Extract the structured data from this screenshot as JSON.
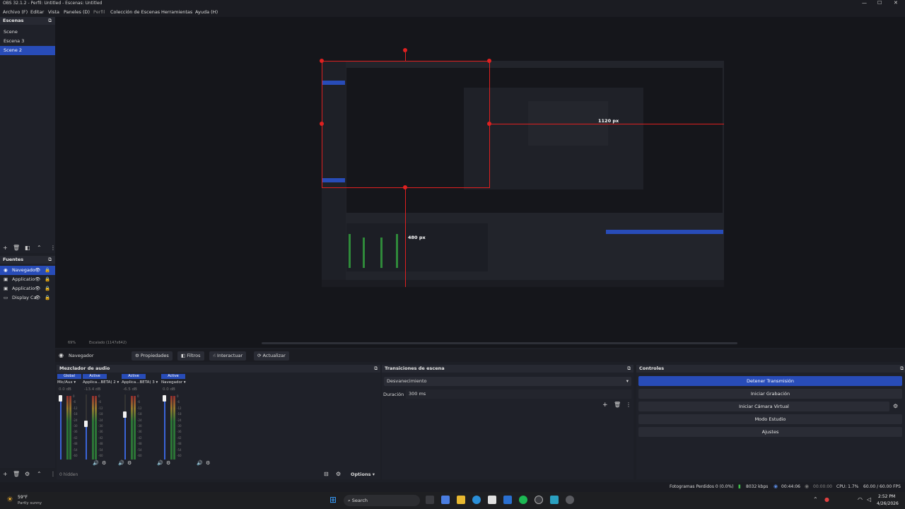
{
  "window": {
    "title": "OBS 32.1.2 - Perfil: Untitled - Escenas: Untitled"
  },
  "menu": [
    "Archivo (F)",
    "Editar",
    "Vista",
    "Paneles (D)",
    "Perfil",
    "Colección de Escenas",
    "Herramientas",
    "Ayuda (H)"
  ],
  "scenes": {
    "header": "Escenas",
    "items": [
      "Scene",
      "Escena 3",
      "Scene 2"
    ],
    "selected": "Scene 2"
  },
  "sources": {
    "header": "Fuentes",
    "items": [
      "Navegado",
      "Applicatio",
      "Applicatio",
      "Display Ca"
    ]
  },
  "preview": {
    "width_label": "1120 px",
    "height_label": "480 px",
    "zoom": "69%",
    "scale_label": "Escalado (1147x642)"
  },
  "context_bar": {
    "source_name": "Navegador",
    "properties": "Propiedades",
    "filters": "Filtros",
    "interact": "Interactuar",
    "refresh": "Actualizar"
  },
  "mixer": {
    "header": "Mezclador de audio",
    "channels": [
      {
        "name": "Mic/Aux",
        "status": "Global",
        "db": "0.0 dB",
        "level": 0.95
      },
      {
        "name": "Applica...BETA) 2",
        "status": "Active",
        "db": "-13.4 dB",
        "level": 0.55
      },
      {
        "name": "Applica...BETA) 3",
        "status": "Active",
        "db": "-6.5 dB",
        "level": 0.7
      },
      {
        "name": "Navegador",
        "status": "Active",
        "db": "0.0 dB",
        "level": 0.95
      }
    ],
    "scale": [
      "0",
      "-6",
      "-12",
      "-18",
      "-24",
      "-30",
      "-36",
      "-42",
      "-48",
      "-54",
      "-60"
    ],
    "hidden_label": "0 hidden",
    "options": "Options"
  },
  "transitions": {
    "header": "Transiciones de escena",
    "selected": "Desvanecimiento",
    "duration_label": "Duración",
    "duration_value": "300 ms"
  },
  "controls": {
    "header": "Controles",
    "buttons": [
      "Detener Transmisión",
      "Iniciar Grabación",
      "Iniciar Cámara Virtual",
      "Modo Estudio",
      "Ajustes"
    ]
  },
  "status": {
    "dropped": "Fotogramas Perdidos 0 (0.0%)",
    "bitrate": "8032 kbps",
    "stream_time": "00:44:06",
    "rec_time": "00:00:00",
    "cpu": "CPU: 1.7%",
    "fps": "60.00 / 60.00 FPS"
  },
  "taskbar": {
    "weather_temp": "59°F",
    "weather_desc": "Partly sunny",
    "search": "Search",
    "time": "2:52 PM",
    "date": "4/26/2026"
  },
  "colors": {
    "accent": "#284cb8",
    "guide": "#e02020"
  }
}
